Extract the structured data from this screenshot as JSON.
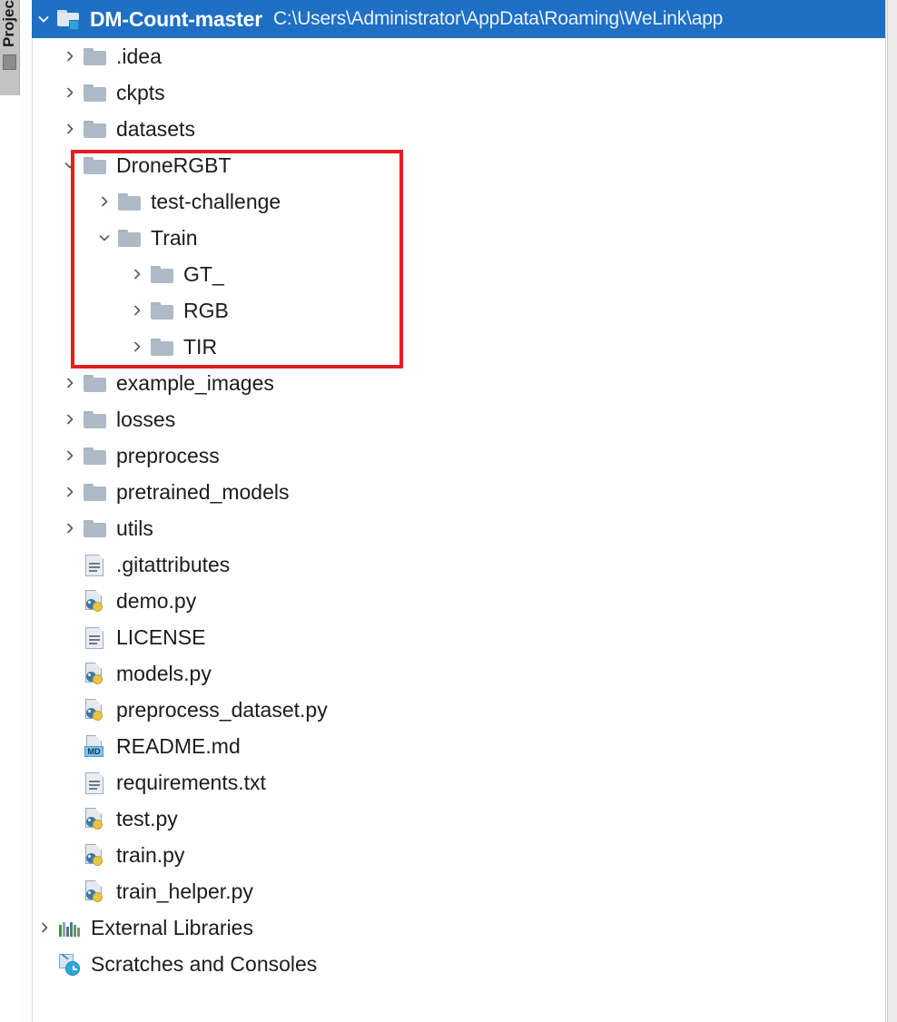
{
  "tool_window": {
    "label": "Project",
    "chip": "minimize-chip"
  },
  "project_root": {
    "name": "DM-Count-master",
    "path": "C:\\Users\\Administrator\\AppData\\Roaming\\WeLink\\app",
    "expanded": true,
    "chevron": "chevron-down-icon",
    "icon": "project-folder-icon",
    "selected": true,
    "selection_color": "#1f6fc4"
  },
  "annotation": {
    "type": "rectangle-highlight",
    "color": "#e02020",
    "covers": [
      "DroneRGBT",
      "test-challenge",
      "Train",
      "GT_",
      "RGB",
      "TIR"
    ]
  },
  "tree": [
    {
      "label": ".idea",
      "icon": "folder-icon",
      "chevron": "chevron-right-icon",
      "indent": 1,
      "expanded": false
    },
    {
      "label": "ckpts",
      "icon": "folder-icon",
      "chevron": "chevron-right-icon",
      "indent": 1,
      "expanded": false
    },
    {
      "label": "datasets",
      "icon": "folder-icon",
      "chevron": "chevron-right-icon",
      "indent": 1,
      "expanded": false
    },
    {
      "label": "DroneRGBT",
      "icon": "folder-icon",
      "chevron": "chevron-down-icon",
      "indent": 1,
      "expanded": true
    },
    {
      "label": "test-challenge",
      "icon": "folder-icon",
      "chevron": "chevron-right-icon",
      "indent": 2,
      "expanded": false
    },
    {
      "label": "Train",
      "icon": "folder-icon",
      "chevron": "chevron-down-icon",
      "indent": 2,
      "expanded": true
    },
    {
      "label": "GT_",
      "icon": "folder-icon",
      "chevron": "chevron-right-icon",
      "indent": 3,
      "expanded": false
    },
    {
      "label": "RGB",
      "icon": "folder-icon",
      "chevron": "chevron-right-icon",
      "indent": 3,
      "expanded": false
    },
    {
      "label": "TIR",
      "icon": "folder-icon",
      "chevron": "chevron-right-icon",
      "indent": 3,
      "expanded": false
    },
    {
      "label": "example_images",
      "icon": "folder-icon",
      "chevron": "chevron-right-icon",
      "indent": 1,
      "expanded": false
    },
    {
      "label": "losses",
      "icon": "folder-icon",
      "chevron": "chevron-right-icon",
      "indent": 1,
      "expanded": false
    },
    {
      "label": "preprocess",
      "icon": "folder-icon",
      "chevron": "chevron-right-icon",
      "indent": 1,
      "expanded": false
    },
    {
      "label": "pretrained_models",
      "icon": "folder-icon",
      "chevron": "chevron-right-icon",
      "indent": 1,
      "expanded": false
    },
    {
      "label": "utils",
      "icon": "folder-icon",
      "chevron": "chevron-right-icon",
      "indent": 1,
      "expanded": false
    },
    {
      "label": ".gitattributes",
      "icon": "text-file-icon",
      "chevron": "none",
      "indent": 1,
      "expanded": false
    },
    {
      "label": "demo.py",
      "icon": "python-file-icon",
      "chevron": "none",
      "indent": 1,
      "expanded": false
    },
    {
      "label": "LICENSE",
      "icon": "text-file-icon",
      "chevron": "none",
      "indent": 1,
      "expanded": false
    },
    {
      "label": "models.py",
      "icon": "python-file-icon",
      "chevron": "none",
      "indent": 1,
      "expanded": false
    },
    {
      "label": "preprocess_dataset.py",
      "icon": "python-file-icon",
      "chevron": "none",
      "indent": 1,
      "expanded": false
    },
    {
      "label": "README.md",
      "icon": "markdown-file-icon",
      "chevron": "none",
      "indent": 1,
      "expanded": false,
      "badge": "MD"
    },
    {
      "label": "requirements.txt",
      "icon": "text-file-icon",
      "chevron": "none",
      "indent": 1,
      "expanded": false
    },
    {
      "label": "test.py",
      "icon": "python-file-icon",
      "chevron": "none",
      "indent": 1,
      "expanded": false
    },
    {
      "label": "train.py",
      "icon": "python-file-icon",
      "chevron": "none",
      "indent": 1,
      "expanded": false
    },
    {
      "label": "train_helper.py",
      "icon": "python-file-icon",
      "chevron": "none",
      "indent": 1,
      "expanded": false
    },
    {
      "label": "External Libraries",
      "icon": "external-libraries-icon",
      "chevron": "chevron-right-icon",
      "indent": 0,
      "expanded": false
    },
    {
      "label": "Scratches and Consoles",
      "icon": "scratches-icon",
      "chevron": "none",
      "indent": 0,
      "expanded": false
    }
  ]
}
